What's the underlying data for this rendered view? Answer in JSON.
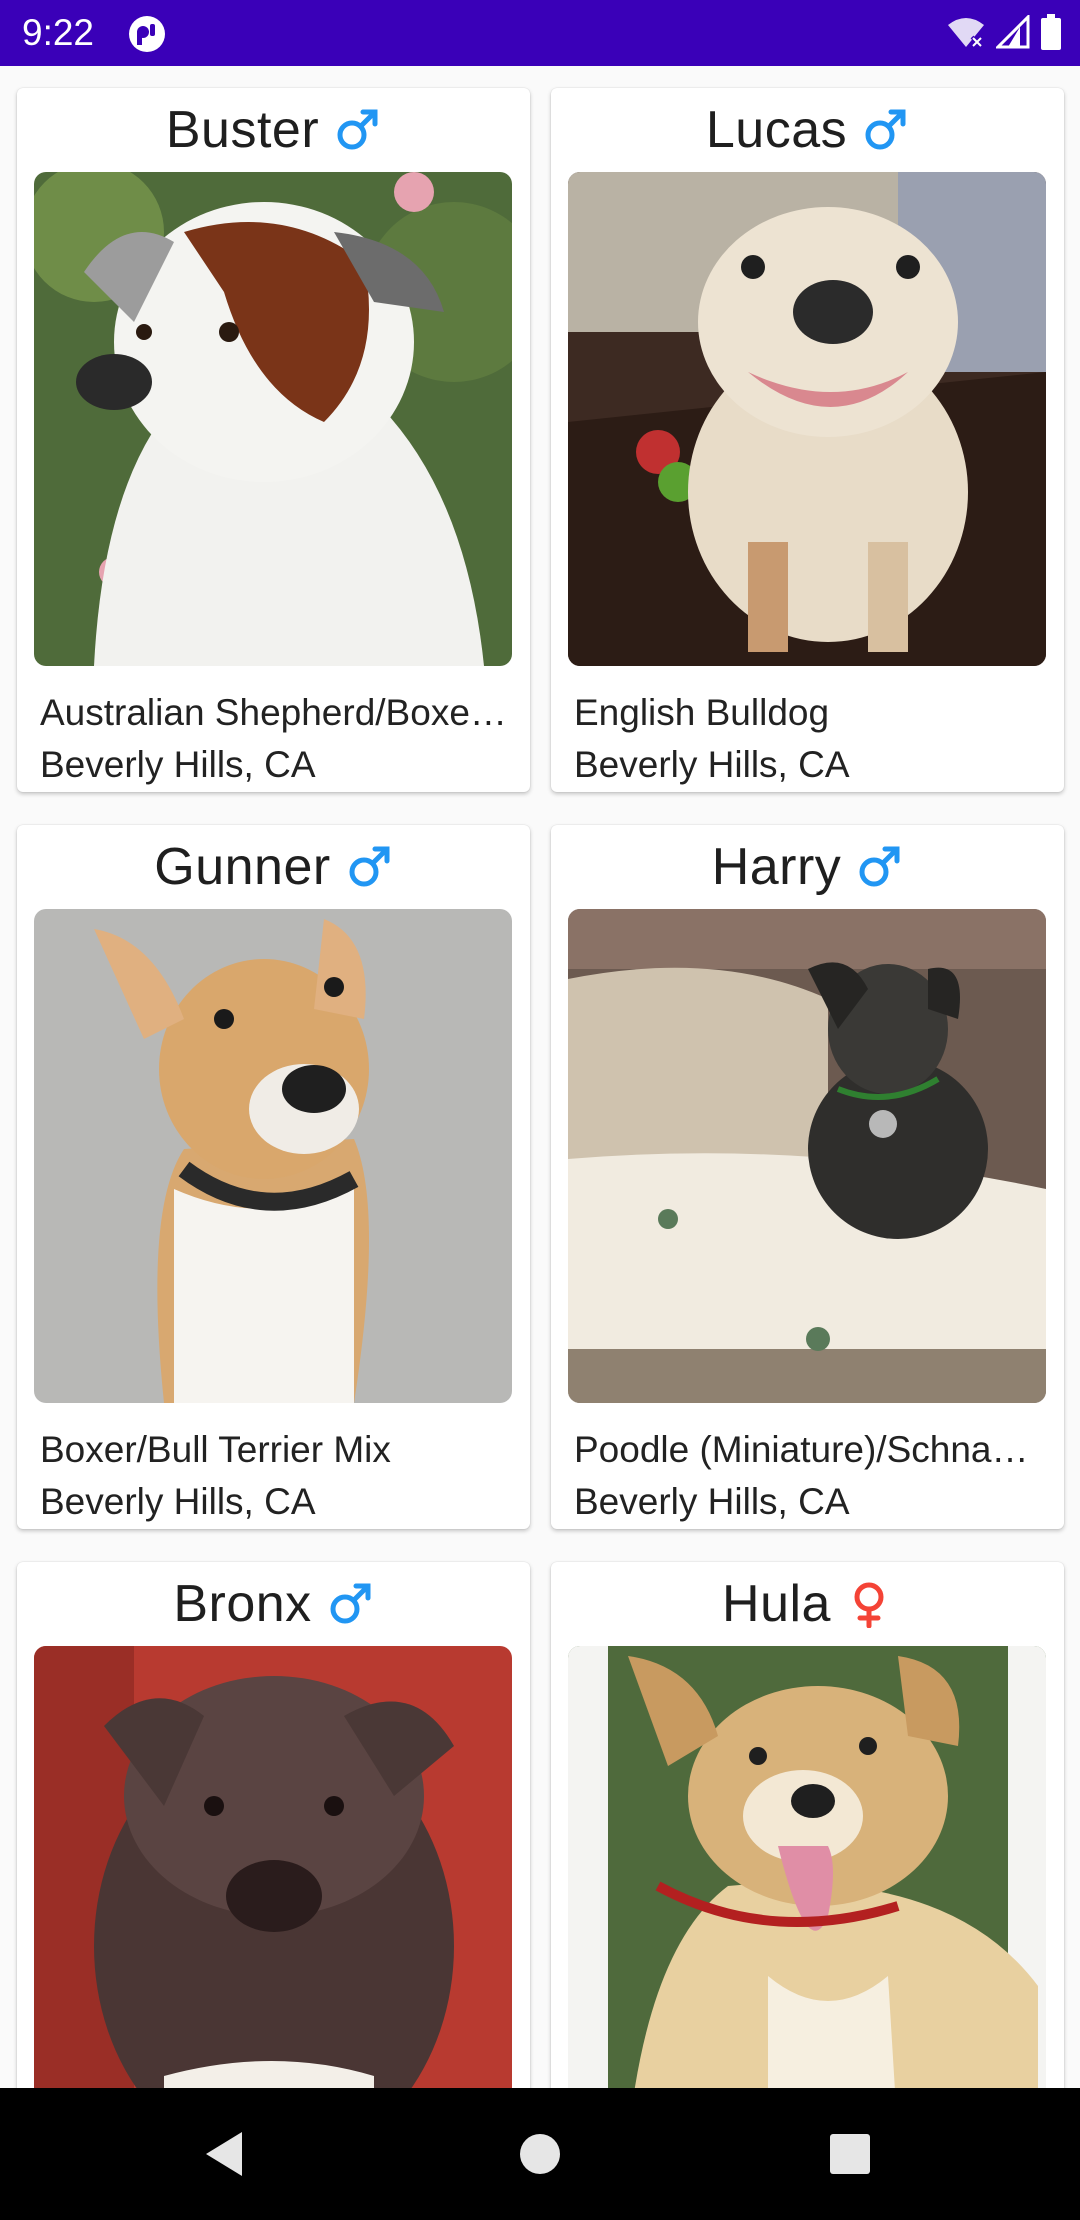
{
  "status_bar": {
    "time": "9:22",
    "background_color": "#3a00b8",
    "icons": [
      "app-notification-icon",
      "wifi-icon",
      "cell-signal-icon",
      "battery-icon"
    ]
  },
  "colors": {
    "male": "#2196f3",
    "female": "#f44336"
  },
  "pets": [
    {
      "name": "Buster",
      "gender": "male",
      "breed": "Australian Shepherd/Boxer Mix",
      "location": "Beverly Hills, CA"
    },
    {
      "name": "Lucas",
      "gender": "male",
      "breed": "English Bulldog",
      "location": "Beverly Hills, CA"
    },
    {
      "name": "Gunner",
      "gender": "male",
      "breed": "Boxer/Bull Terrier Mix",
      "location": "Beverly Hills, CA"
    },
    {
      "name": "Harry",
      "gender": "male",
      "breed": "Poodle (Miniature)/Schnauzer Mix",
      "location": "Beverly Hills, CA"
    },
    {
      "name": "Bronx",
      "gender": "male",
      "breed": "",
      "location": ""
    },
    {
      "name": "Hula",
      "gender": "female",
      "breed": "",
      "location": ""
    }
  ],
  "nav_bar": {
    "buttons": [
      "back-icon",
      "home-icon",
      "recents-icon"
    ]
  }
}
